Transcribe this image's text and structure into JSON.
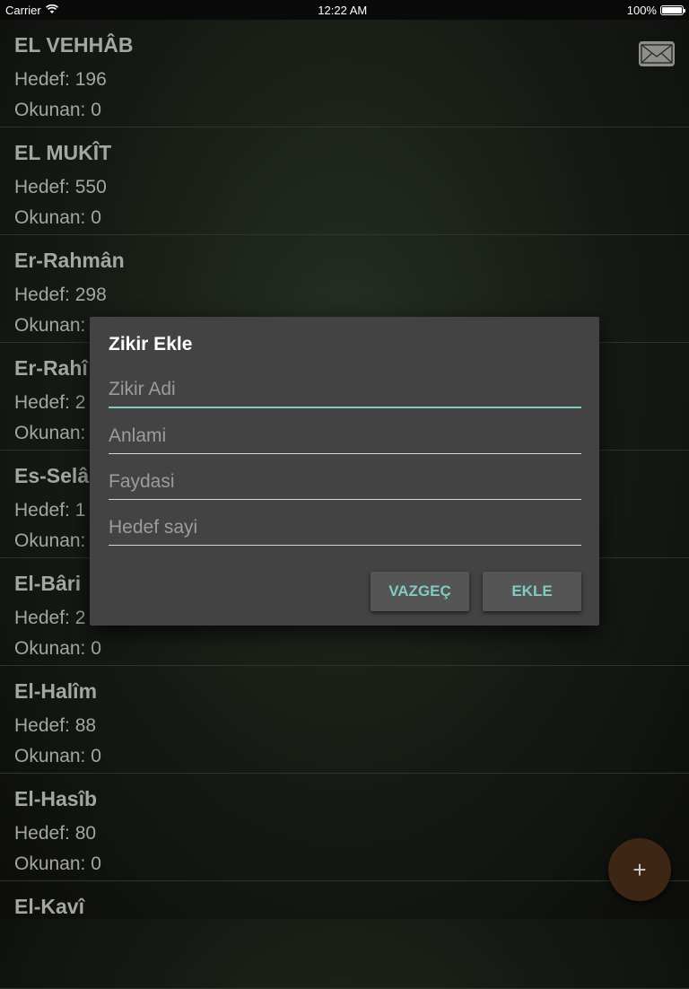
{
  "status_bar": {
    "carrier": "Carrier",
    "time": "12:22 AM",
    "battery": "100%"
  },
  "list": {
    "items": [
      {
        "name": "EL VEHHÂB",
        "hedef": "Hedef: 196",
        "okunan": "Okunan: 0"
      },
      {
        "name": "EL MUKÎT",
        "hedef": "Hedef: 550",
        "okunan": "Okunan: 0"
      },
      {
        "name": "Er-Rahmân",
        "hedef": "Hedef: 298",
        "okunan": "Okunan:"
      },
      {
        "name": "Er-Rahî",
        "hedef": "Hedef: 2",
        "okunan": "Okunan:"
      },
      {
        "name": "Es-Selâ",
        "hedef": "Hedef: 1",
        "okunan": "Okunan:"
      },
      {
        "name": "El-Bâri",
        "hedef": "Hedef: 2",
        "okunan": "Okunan: 0"
      },
      {
        "name": "El-Halîm",
        "hedef": "Hedef: 88",
        "okunan": "Okunan: 0"
      },
      {
        "name": "El-Hasîb",
        "hedef": "Hedef: 80",
        "okunan": "Okunan: 0"
      },
      {
        "name": "El-Kavî",
        "hedef": "",
        "okunan": ""
      }
    ]
  },
  "icons": {
    "mail": "envelope-icon",
    "fab": "plus-icon",
    "fab_glyph": "+"
  },
  "dialog": {
    "title": "Zikir Ekle",
    "fields": {
      "name_placeholder": "Zikir Adi",
      "meaning_placeholder": "Anlami",
      "benefit_placeholder": "Faydasi",
      "target_placeholder": "Hedef sayi"
    },
    "cancel_label": "VAZGEÇ",
    "add_label": "EKLE"
  },
  "colors": {
    "accent": "#80cbc4",
    "dialog_bg": "#434343",
    "fab_bg": "#3d2613",
    "text_muted": "#a4a6a1"
  }
}
